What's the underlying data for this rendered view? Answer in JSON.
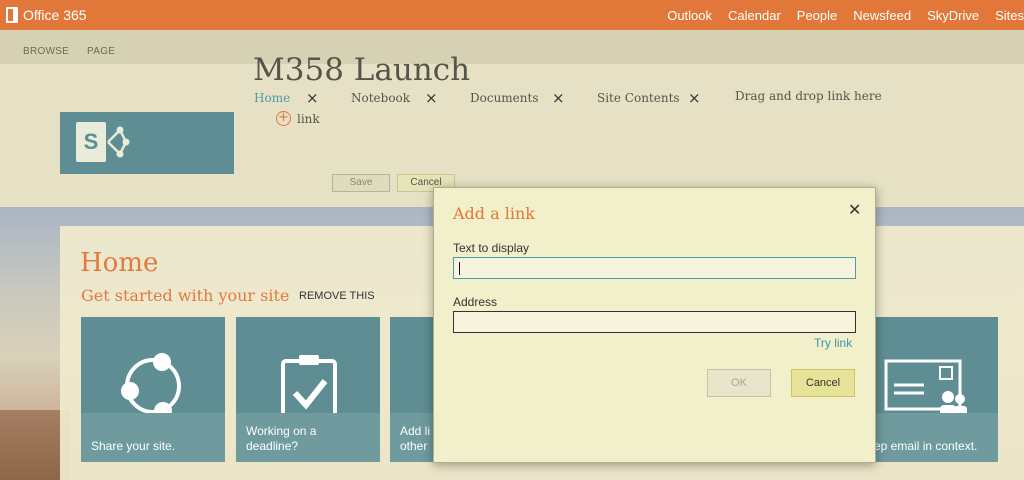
{
  "suitebar": {
    "brand": "Office 365",
    "nav": [
      "Outlook",
      "Calendar",
      "People",
      "Newsfeed",
      "SkyDrive",
      "Sites"
    ]
  },
  "ribbon": {
    "tabs": [
      "BROWSE",
      "PAGE"
    ]
  },
  "site": {
    "title": "M358 Launch",
    "topnav": [
      "Home",
      "Notebook",
      "Documents",
      "Site Contents",
      "Drag and drop link here"
    ],
    "add_link_label": "link",
    "save_label": "Save",
    "cancel_label": "Cancel"
  },
  "home": {
    "title": "Home",
    "subtitle": "Get started with your site",
    "remove_label": "REMOVE THIS",
    "tiles": [
      {
        "line1": "Share your site.",
        "line2": "",
        "icon": "share-icon"
      },
      {
        "line1": "Working on a",
        "line2": "deadline?",
        "icon": "clipboard-check-icon"
      },
      {
        "line1": "Add li",
        "line2": "other",
        "icon": ""
      },
      {
        "line1": "ep email in context.",
        "line2": "",
        "icon": "mailbox-people-icon"
      }
    ]
  },
  "modal": {
    "title": "Add a link",
    "text_label": "Text to display",
    "text_value": "",
    "address_label": "Address",
    "address_value": "",
    "try_link": "Try link",
    "ok_label": "OK",
    "cancel_label": "Cancel"
  },
  "colors": {
    "suitebar": "#e2773a",
    "accent_orange": "#e27a3e",
    "tile": "#5e8e93",
    "link_blue": "#3c96a8"
  }
}
